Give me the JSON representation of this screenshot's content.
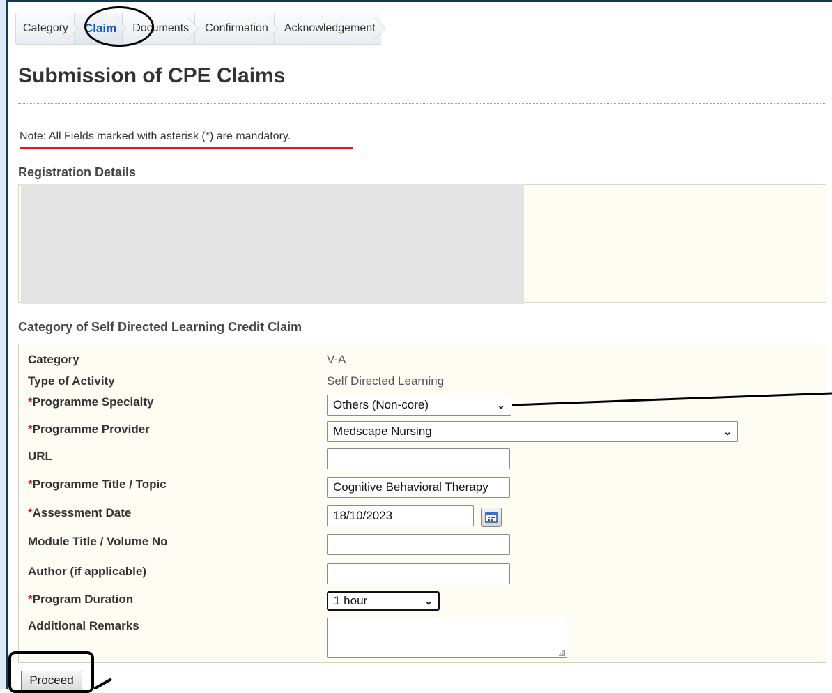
{
  "breadcrumb": {
    "steps": [
      {
        "label": "Category",
        "active": false
      },
      {
        "label": "Claim",
        "active": true
      },
      {
        "label": "Documents",
        "active": false
      },
      {
        "label": "Confirmation",
        "active": false
      },
      {
        "label": "Acknowledgement",
        "active": false
      }
    ]
  },
  "page": {
    "title": "Submission of CPE Claims",
    "note_prefix": "Note: All Fields marked with asterisk (",
    "note_star": "*",
    "note_suffix": ") are mandatory."
  },
  "registration": {
    "heading": "Registration Details"
  },
  "claim": {
    "heading": "Category of Self Directed Learning Credit Claim",
    "fields": {
      "category": {
        "label": "Category",
        "value": "V-A"
      },
      "activity_type": {
        "label": "Type of Activity",
        "value": "Self Directed Learning"
      },
      "specialty": {
        "required": "*",
        "label": "Programme Specialty",
        "selected": "Others (Non-core)"
      },
      "provider": {
        "required": "*",
        "label": "Programme Provider",
        "selected": "Medscape Nursing"
      },
      "url": {
        "label": "URL",
        "value": ""
      },
      "title": {
        "required": "*",
        "label": "Programme Title / Topic",
        "value": "Cognitive Behavioral Therapy"
      },
      "assessment_date": {
        "required": "*",
        "label": "Assessment Date",
        "value": "18/10/2023"
      },
      "module": {
        "label": "Module Title / Volume No",
        "value": ""
      },
      "author": {
        "label": "Author (if applicable)",
        "value": ""
      },
      "duration": {
        "required": "*",
        "label": "Program Duration",
        "selected": "1 hour"
      },
      "remarks": {
        "label": "Additional Remarks",
        "value": ""
      }
    }
  },
  "actions": {
    "proceed_label": "Proceed"
  },
  "icons": {
    "calendar": "calendar-icon",
    "dropdown": "chevron-down-icon"
  },
  "colors": {
    "required": "#dd1111",
    "active_step": "#1158b8",
    "annotation_underline": "#e3161b"
  }
}
